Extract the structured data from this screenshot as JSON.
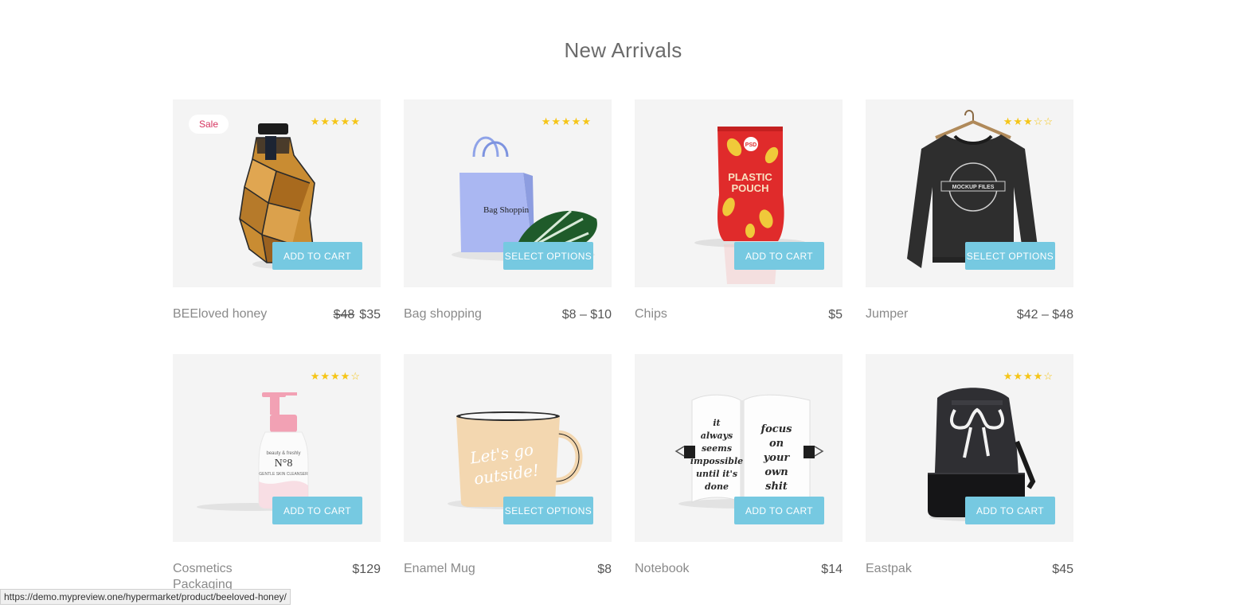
{
  "section": {
    "title": "New Arrivals"
  },
  "products": [
    {
      "name": "BEEloved honey",
      "price_old": "$48",
      "price": "$35",
      "sale": "Sale",
      "stars": "★★★★★",
      "stars_off": "",
      "button": "ADD TO CART",
      "art": "honey"
    },
    {
      "name": "Bag shopping",
      "price": "$8 – $10",
      "stars": "★★★★★",
      "stars_off": "",
      "button": "SELECT OPTIONS",
      "art": "bag"
    },
    {
      "name": "Chips",
      "price": "$5",
      "stars": "",
      "stars_off": "",
      "button": "ADD TO CART",
      "art": "chips"
    },
    {
      "name": "Jumper",
      "price": "$42 – $48",
      "stars": "★★★",
      "stars_off": "☆☆",
      "button": "SELECT OPTIONS",
      "art": "jumper"
    },
    {
      "name": "Cosmetics Packaging",
      "price": "$129",
      "stars": "★★★★",
      "stars_off": "☆",
      "button": "ADD TO CART",
      "art": "cosmetics"
    },
    {
      "name": "Enamel Mug",
      "price": "$8",
      "stars": "",
      "stars_off": "",
      "button": "SELECT OPTIONS",
      "art": "mug"
    },
    {
      "name": "Notebook",
      "price": "$14",
      "stars": "",
      "stars_off": "",
      "button": "ADD TO CART",
      "art": "notebook"
    },
    {
      "name": "Eastpak",
      "price": "$45",
      "stars": "★★★★",
      "stars_off": "☆",
      "button": "ADD TO CART",
      "art": "backpack"
    }
  ],
  "art_text": {
    "bag": "Bag Shoppin",
    "chips_line1": "PLASTIC",
    "chips_line2": "POUCH",
    "chips_badge": "PSD",
    "jumper": "MOCKUP FILES",
    "cosmetics_line1": "beauty & freshly",
    "cosmetics_line2": "N°8",
    "cosmetics_line3": "GENTLE SKIN CLEANSER",
    "mug_line1": "Let's go",
    "mug_line2": "outside!",
    "notebook_left": [
      "it",
      "always",
      "seems",
      "impossible",
      "until it's",
      "done"
    ],
    "notebook_right": [
      "focus",
      "on",
      "your",
      "own",
      "shit"
    ]
  },
  "status_bar": {
    "url": "https://demo.mypreview.one/hypermarket/product/beeloved-honey/"
  },
  "colors": {
    "button": "#76c9e1",
    "sale": "#d6335f",
    "star": "#f5c518",
    "thumb_bg": "#f4f4f4"
  }
}
